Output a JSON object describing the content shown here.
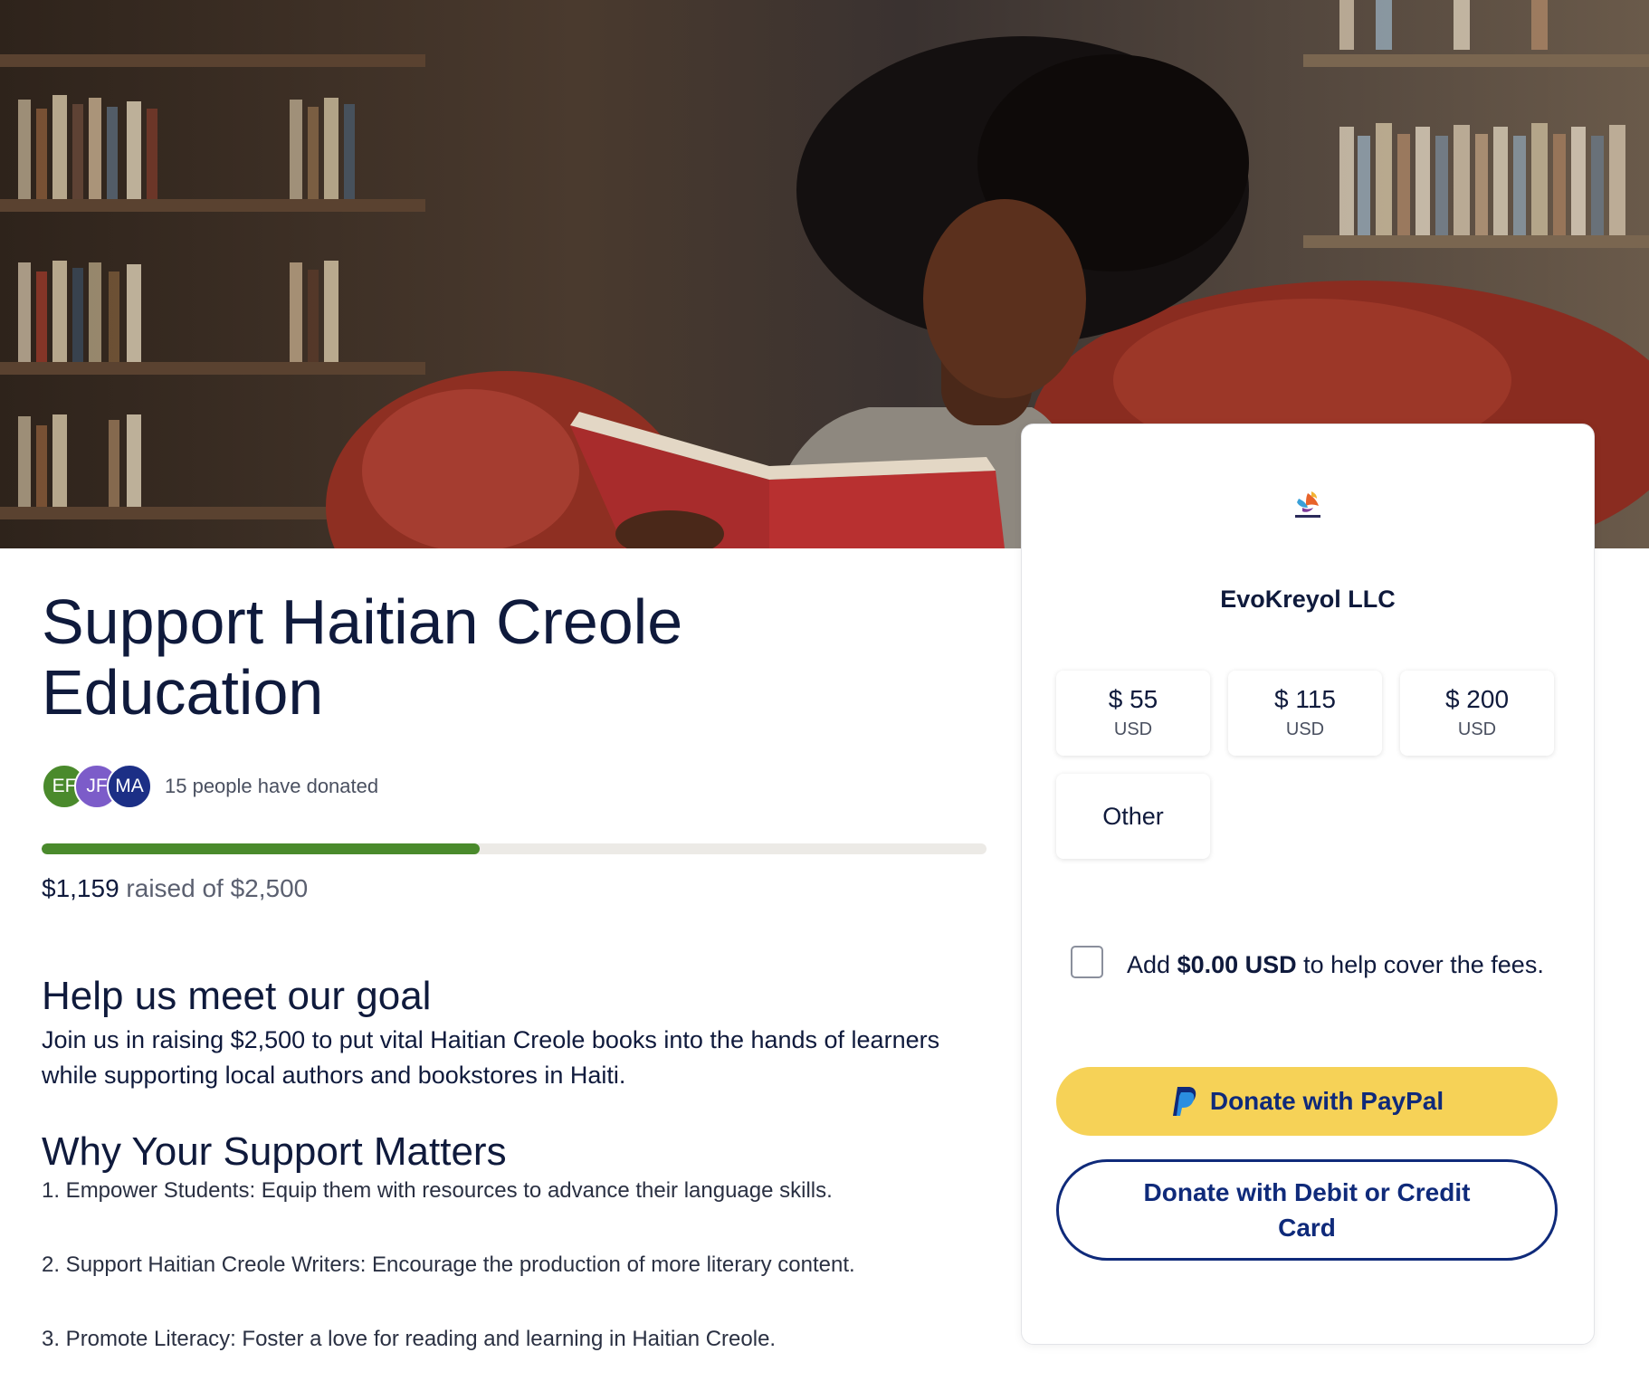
{
  "campaign": {
    "title": "Support Haitian Creole Education",
    "donors_text": "15 people have donated",
    "avatars": [
      {
        "initials": "EF",
        "color": "#4a8a2c"
      },
      {
        "initials": "JF",
        "color": "#7c5cc9"
      },
      {
        "initials": "MA",
        "color": "#1c2f86"
      }
    ],
    "progress": {
      "raised": "$1,159",
      "of_text": "raised of $2,500",
      "fraction": 0.4636
    },
    "goal_heading": "Help us meet our goal",
    "goal_text": "Join us in raising $2,500 to put vital Haitian Creole books into the hands of learners while supporting local authors and bookstores in Haiti.",
    "why_heading": "Why Your Support Matters",
    "why_items": [
      "1. Empower Students: Equip them with resources to advance their language skills.",
      "2. Support Haitian Creole Writers: Encourage the production of more literary content.",
      "3. Promote Literacy: Foster a love for reading and learning in Haitian Creole."
    ]
  },
  "donation": {
    "org_name": "EvoKreyol LLC",
    "amounts": [
      {
        "amount": "$ 55",
        "currency": "USD"
      },
      {
        "amount": "$ 115",
        "currency": "USD"
      },
      {
        "amount": "$ 200",
        "currency": "USD"
      }
    ],
    "other_label": "Other",
    "fee": {
      "prefix": "Add",
      "amount": "$0.00 USD",
      "suffix": "to help cover the fees.",
      "checked": false
    },
    "paypal_label": "Donate with PayPal",
    "card_label": "Donate with Debit or Credit Card"
  },
  "colors": {
    "navy": "#0f1a3c",
    "paypal_yellow": "#f6d257",
    "paypal_blue": "#0f2a7a",
    "progress_green": "#4a8a2c"
  },
  "icons": {
    "logo": "evokreyol-logo",
    "paypal": "paypal-icon"
  }
}
